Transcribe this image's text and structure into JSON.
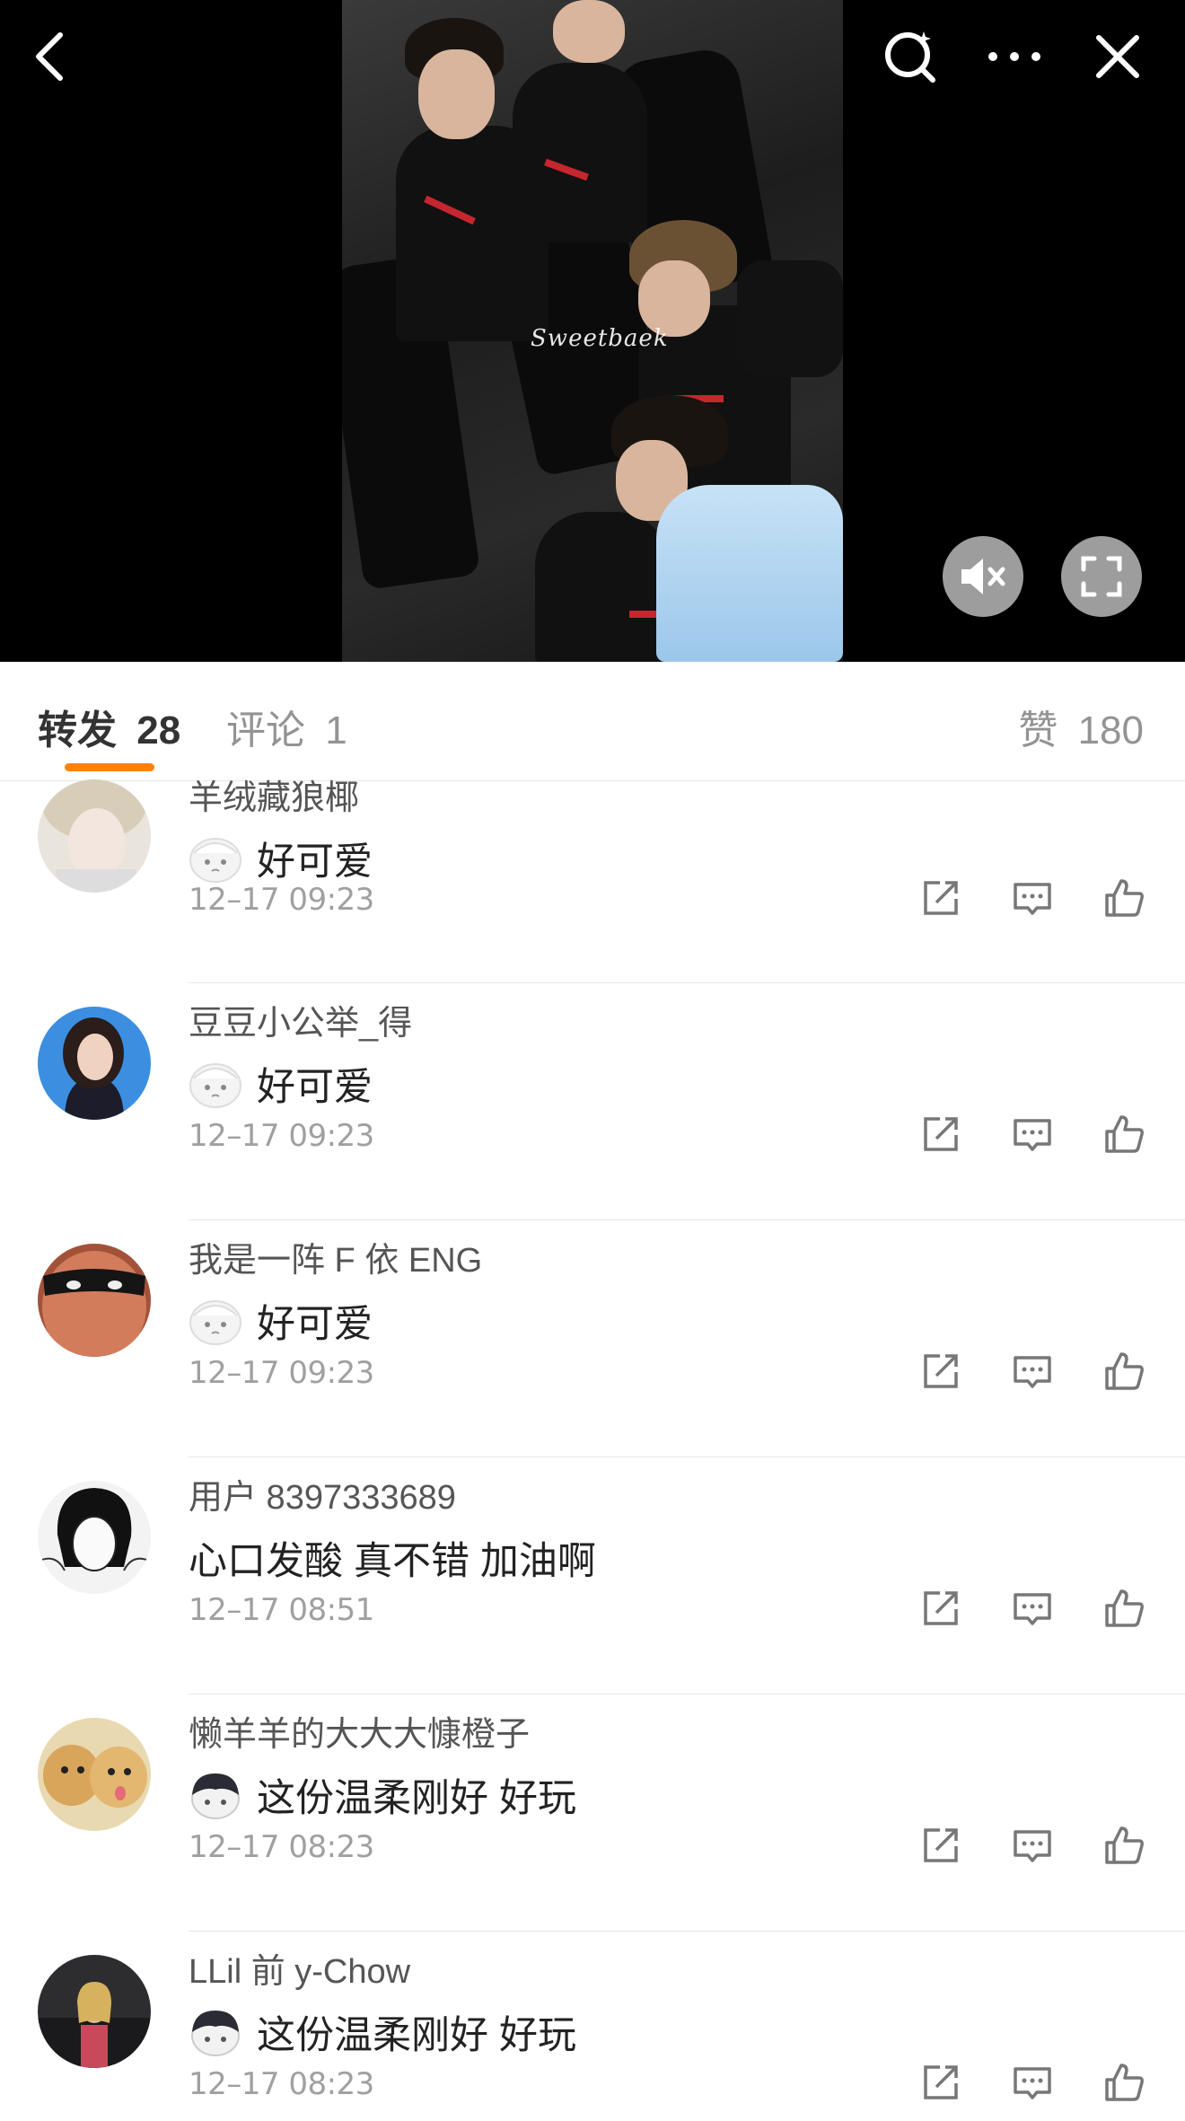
{
  "video": {
    "watermark": "Sweetbaek"
  },
  "tabs": {
    "repost_label": "转发",
    "repost_count": "28",
    "comment_label": "评论",
    "comment_count": "1",
    "like_label": "赞",
    "like_count": "180"
  },
  "reposts": [
    {
      "name": "羊绒藏狼椰",
      "emoji": "crying-face",
      "text": "好可爱",
      "time": "12–17 09:23"
    },
    {
      "name": "豆豆小公举_得",
      "emoji": "crying-face",
      "text": "好可爱",
      "time": "12–17 09:23"
    },
    {
      "name": "我是一阵 F 依 ENG",
      "emoji": "crying-face",
      "text": "好可爱",
      "time": "12–17 09:23"
    },
    {
      "name": "用户 8397333689",
      "emoji": "",
      "text": "心口发酸 真不错 加油啊",
      "time": "12–17 08:51"
    },
    {
      "name": "懒羊羊的大大大慷橙子",
      "emoji": "dark-hair-face",
      "text": "这份温柔刚好 好玩",
      "time": "12–17 08:23"
    },
    {
      "name": "LLil 前 y-Chow",
      "emoji": "dark-hair-face",
      "text": "这份温柔刚好 好玩",
      "time": "12–17 08:23"
    }
  ],
  "colors": {
    "accent": "#ff8200",
    "jacket_stripe": "#c6262e"
  },
  "icons": [
    "back-icon",
    "search-icon",
    "more-icon",
    "close-icon",
    "mute-icon",
    "fullscreen-icon",
    "repost-icon",
    "comment-icon",
    "like-icon"
  ]
}
